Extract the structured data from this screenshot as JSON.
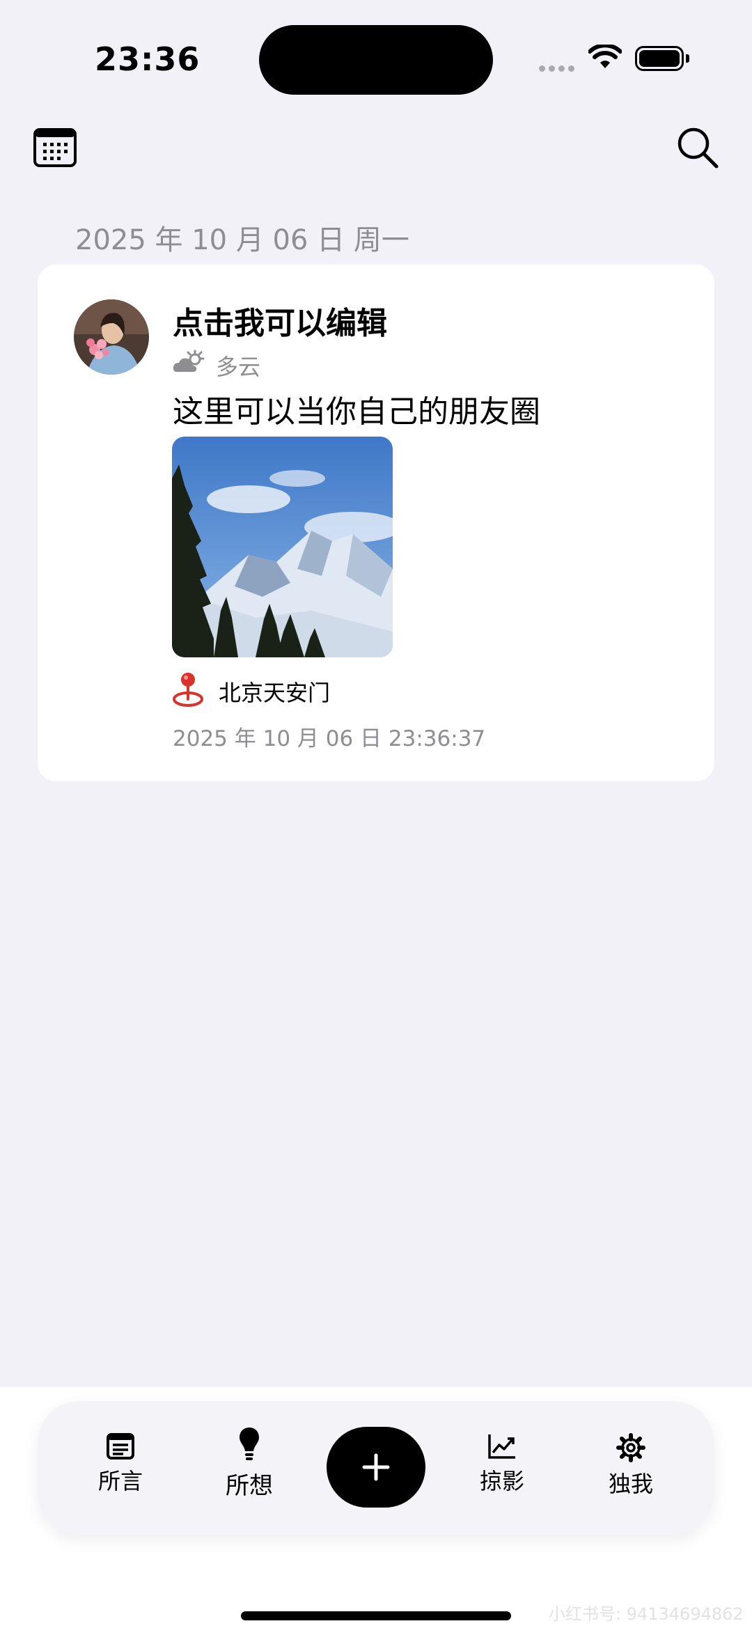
{
  "status_bar": {
    "time": "23:36"
  },
  "header": {
    "date": "2025 年 10 月 06 日 周一"
  },
  "post": {
    "title": "点击我可以编辑",
    "weather": "多云",
    "text": "这里可以当你自己的朋友圈",
    "location": "北京天安门",
    "timestamp": "2025 年 10 月 06 日 23:36:37"
  },
  "tabs": {
    "t1": "所言",
    "t2": "所想",
    "t3": "掠影",
    "t4": "独我"
  },
  "watermark": "小红书号: 94134694862",
  "icons": [
    "calendar-icon",
    "search-icon",
    "weather-cloudy-icon",
    "location-pin-icon",
    "document-icon",
    "lightbulb-icon",
    "plus-icon",
    "chart-icon",
    "gear-icon"
  ],
  "colors": {
    "background": "#f1f1f7",
    "card": "#ffffff",
    "accent": "#000000",
    "pin": "#d9342b",
    "muted": "#8d8d92"
  }
}
